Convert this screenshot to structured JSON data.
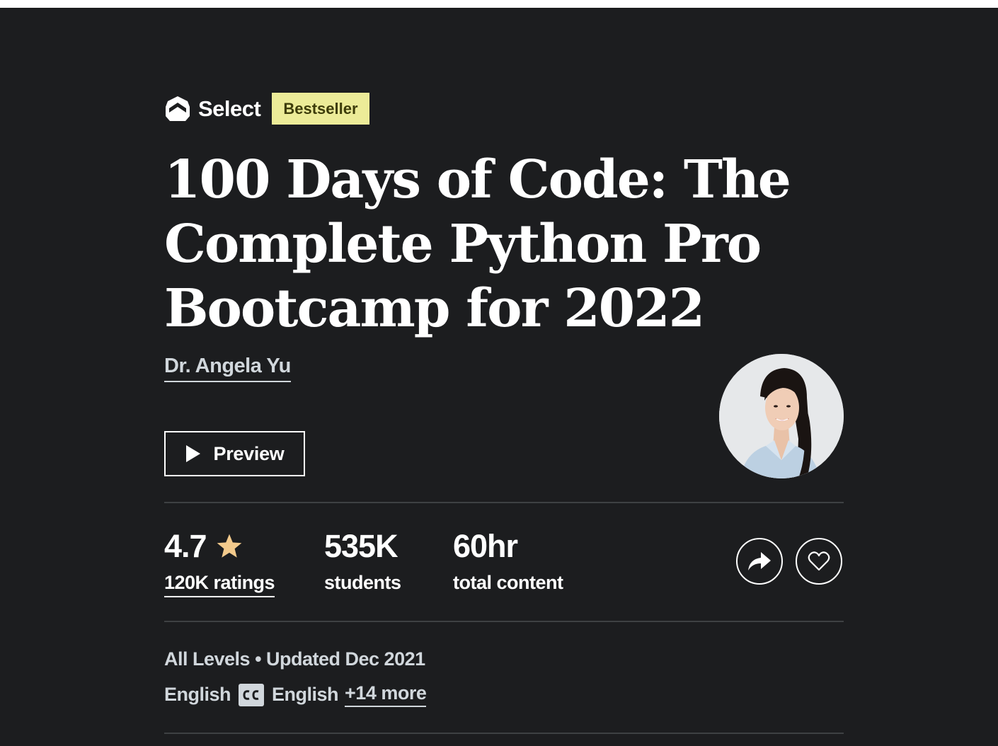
{
  "badges": {
    "select_label": "Select",
    "bestseller_label": "Bestseller",
    "bestseller_bg": "#eceb98"
  },
  "course": {
    "title_line1": "100 Days of Code: The",
    "title_line2": "Complete Python Pro",
    "title_line3": "Bootcamp for 2022",
    "instructor": "Dr. Angela Yu"
  },
  "actions": {
    "preview_label": "Preview",
    "share_icon": "share-icon",
    "wishlist_icon": "heart-icon"
  },
  "stats": {
    "rating": "4.7",
    "ratings_count": "120K ratings",
    "students_value": "535K",
    "students_label": "students",
    "content_value": "60hr",
    "content_label": "total content",
    "star_color": "#f3ca8c"
  },
  "meta": {
    "level_updated": "All Levels • Updated Dec 2021",
    "language": "English",
    "caption_language": "English",
    "more_languages": "+14 more"
  },
  "colors": {
    "background": "#1c1d1f",
    "divider": "#3e4143",
    "muted_text": "#d1d7dc"
  }
}
